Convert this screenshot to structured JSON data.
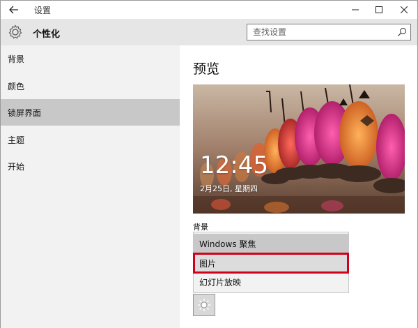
{
  "window": {
    "title": "设置",
    "back_icon": "arrow-left-icon",
    "controls": [
      "minimize-icon",
      "maximize-icon",
      "close-icon"
    ]
  },
  "header": {
    "title": "个性化",
    "icon": "gear-icon",
    "search": {
      "placeholder": "查找设置",
      "icon": "search-icon"
    }
  },
  "sidebar": {
    "items": [
      {
        "label": "背景",
        "active": false
      },
      {
        "label": "颜色",
        "active": false
      },
      {
        "label": "锁屏界面",
        "active": true
      },
      {
        "label": "主题",
        "active": false
      },
      {
        "label": "开始",
        "active": false
      }
    ]
  },
  "main": {
    "section_title": "预览",
    "preview": {
      "time": "12:45",
      "date": "2月25日, 星期四"
    },
    "background_label": "背景",
    "dropdown": {
      "options": [
        {
          "label": "Windows 聚焦",
          "state": "selected"
        },
        {
          "label": "图片",
          "state": "highlighted"
        },
        {
          "label": "幻灯片放映",
          "state": "normal"
        }
      ]
    },
    "brightness_icon": "sun-icon"
  },
  "colors": {
    "sidebar_bg": "#f2f2f2",
    "active_item_bg": "#c8c8c8",
    "header_bg": "#e6e6e6",
    "highlight_border": "#d0021b"
  }
}
